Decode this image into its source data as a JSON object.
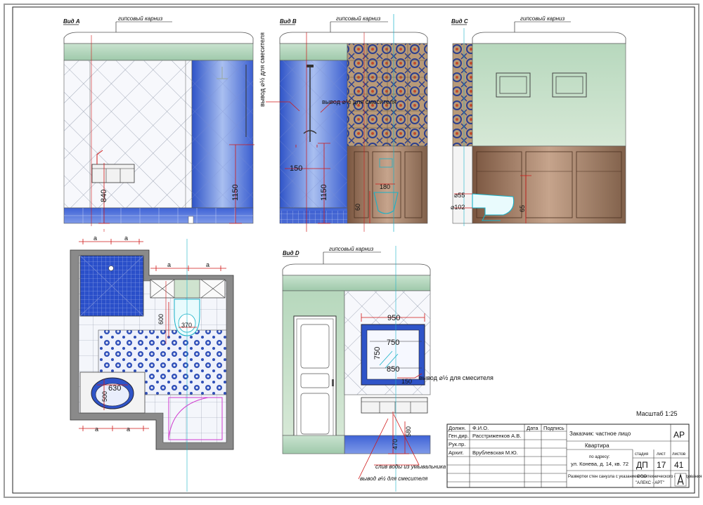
{
  "views": {
    "a": {
      "label": "Вид А",
      "cornice": "гипсовый карниз",
      "dim_sink_h": "840",
      "dim_shower_h": "1150"
    },
    "b": {
      "label": "Вид В",
      "cornice": "гипсовый карниз",
      "note_left": "вывод ⌀½ для смесителя",
      "note_right": "вывод ⌀½ для смесителя",
      "dim_150": "150",
      "dim_1150": "1150",
      "dim_wc_w": "180",
      "dim_wc_h": "60"
    },
    "c": {
      "label": "Вид С",
      "cornice": "гипсовый карниз",
      "dim_d55": "⌀55",
      "dim_d102": "⌀102",
      "dim_h": "65"
    },
    "d": {
      "label": "Вид D",
      "cornice": "гипсовый карниз",
      "dim_950": "950",
      "dim_750w": "750",
      "dim_750h": "750",
      "dim_850": "850",
      "dim_150": "150",
      "note_mixer": "вывод ⌀½ для смесителя",
      "dim_470": "470",
      "dim_580": "580",
      "note_drain": "слив воды из умывальника",
      "note_mixer2": "вывод ⌀½ для смесителя"
    }
  },
  "plan": {
    "dim_a": "a",
    "dim_600": "600",
    "dim_370": "370",
    "dim_630": "630",
    "dim_500": "500"
  },
  "scale": "Масштаб 1:25",
  "title_block": {
    "h_position": "Должн.",
    "h_name": "Ф.И.О.",
    "h_date": "Дата",
    "h_sign": "Подпись",
    "rows": [
      {
        "role": "Ген.дир.",
        "name": "Расстриженков А.В."
      },
      {
        "role": "Рук.пр.",
        "name": ""
      },
      {
        "role": "Архит.",
        "name": "Врублевская М.Ю."
      }
    ],
    "client": "Заказчик: частное лицо",
    "object": "Квартира",
    "address_1": "по адресу:",
    "address_2": "ул. Конева, д. 14, кв. 72",
    "sheet_title": "Развертки стен санузла с указанием сантехнического оборудования",
    "h_stage": "стадия",
    "h_sheet": "лист",
    "h_sheets": "листов",
    "code": "АР",
    "stage": "ДП",
    "sheet": "17",
    "sheets": "41",
    "company_1": "ООО",
    "company_2": "\"АЛЕКС - АРТ\""
  }
}
